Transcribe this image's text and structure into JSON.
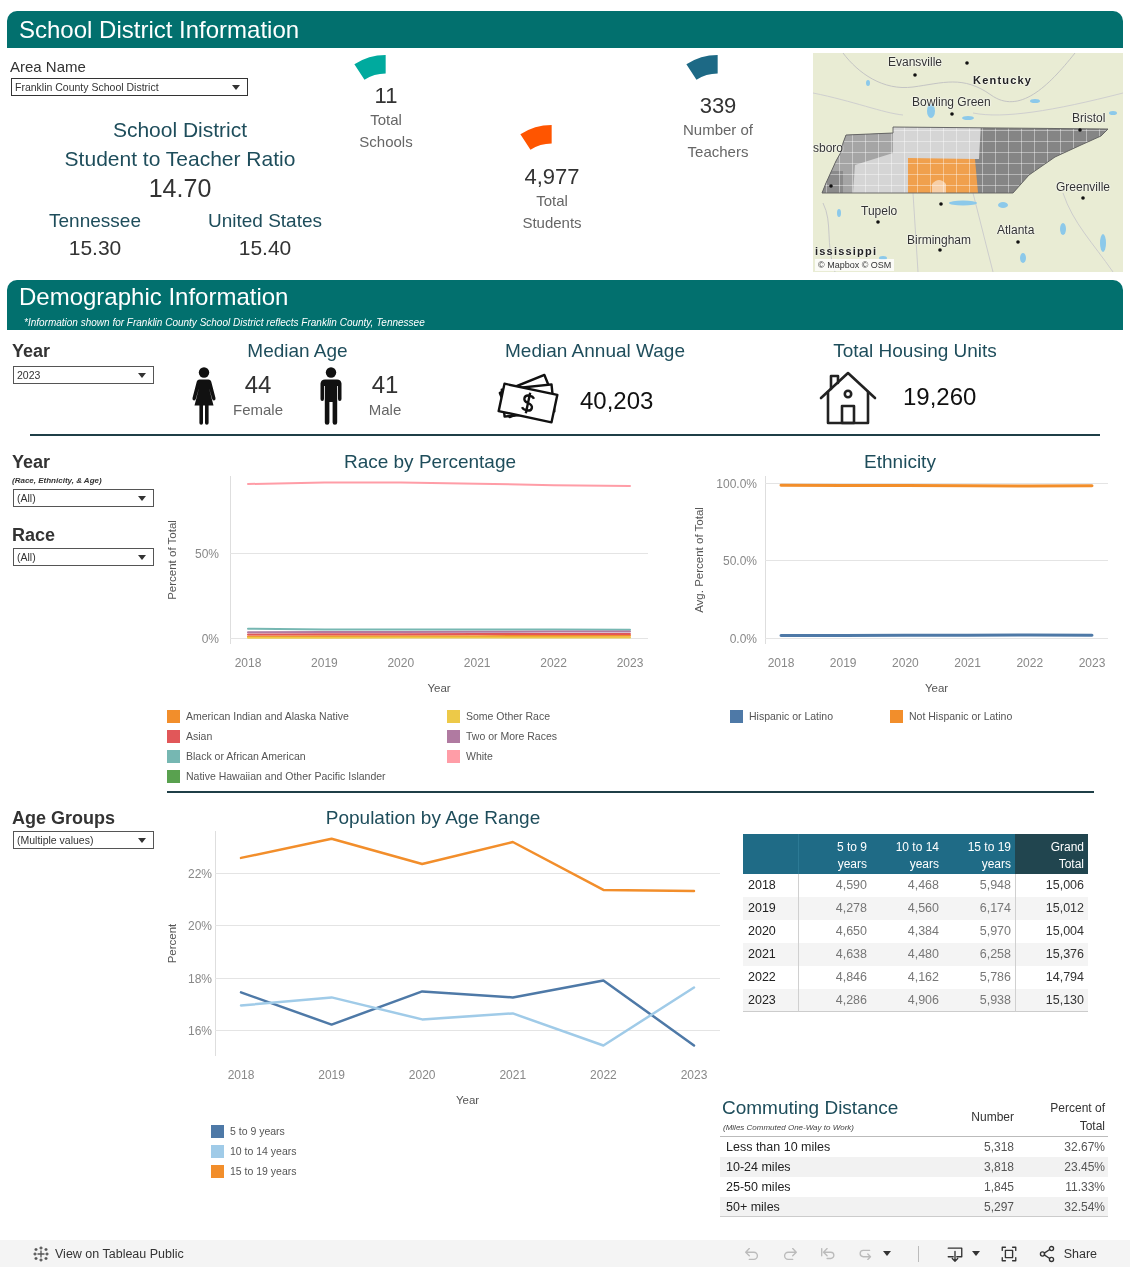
{
  "header": {
    "title": "School District Information"
  },
  "area_filter": {
    "label": "Area Name",
    "value": "Franklin County School District"
  },
  "ratio": {
    "title_lines": [
      "School District",
      "Student to Teacher Ratio"
    ],
    "value": "14.70",
    "comparisons": [
      {
        "label": "Tennessee",
        "value": "15.30"
      },
      {
        "label": "United States",
        "value": "15.40"
      }
    ]
  },
  "kpis": [
    {
      "value": "11",
      "label": "Total Schools",
      "color": "#00aa9e"
    },
    {
      "value": "4,977",
      "label": "Total Students",
      "color": "#ff5500"
    },
    {
      "value": "339",
      "label": "Number of Teachers",
      "color": "#1d6985"
    }
  ],
  "map": {
    "labels": [
      {
        "text": "Evansville",
        "kind": "city"
      },
      {
        "text": "Kentucky",
        "kind": "state"
      },
      {
        "text": "Bowling Green",
        "kind": "city"
      },
      {
        "text": "Bristol",
        "kind": "city"
      },
      {
        "text": "sboro",
        "kind": "city"
      },
      {
        "text": "Greenville",
        "kind": "city"
      },
      {
        "text": "Tupelo",
        "kind": "city"
      },
      {
        "text": "Atlanta",
        "kind": "city"
      },
      {
        "text": "Birmingham",
        "kind": "city"
      },
      {
        "text": "ississippi",
        "kind": "state"
      }
    ],
    "attribution": "© Mapbox © OSM"
  },
  "demographics": {
    "title": "Demographic Information",
    "note": "*Information shown for Franklin County School District reflects Franklin County, Tennessee",
    "year_filter": {
      "label": "Year",
      "value": "2023"
    },
    "median_age": {
      "title": "Median Age",
      "groups": [
        {
          "kind": "female",
          "value": "44",
          "label": "Female"
        },
        {
          "kind": "male",
          "value": "41",
          "label": "Male"
        }
      ]
    },
    "median_wage": {
      "title": "Median Annual Wage",
      "value": "40,203"
    },
    "housing": {
      "title": "Total Housing Units",
      "value": "19,260"
    }
  },
  "filters": [
    {
      "label": "Year",
      "note": "(Race, Ethnicity, & Age)",
      "value": "(All)"
    },
    {
      "label": "Race",
      "value": "(All)"
    }
  ],
  "race_chart": {
    "chart_data": {
      "type": "line",
      "title": "Race by Percentage",
      "xlabel": "Year",
      "ylabel": "Percent of Total",
      "categories": [
        "2018",
        "2019",
        "2020",
        "2021",
        "2022",
        "2023"
      ],
      "series": [
        {
          "name": "American Indian and Alaska Native",
          "color": "#f28e2b",
          "values": [
            0.9,
            1.0,
            1.0,
            1.1,
            1.2,
            1.3
          ]
        },
        {
          "name": "Asian",
          "color": "#e15759",
          "values": [
            2.1,
            2.2,
            2.2,
            2.3,
            2.3,
            2.4
          ]
        },
        {
          "name": "Black or African American",
          "color": "#76b7b2",
          "values": [
            5.5,
            5.0,
            5.1,
            5.1,
            5.0,
            4.9
          ]
        },
        {
          "name": "Native Hawaiian and Other Pacific Islander",
          "color": "#59a14f",
          "values": [
            null,
            null,
            null,
            null,
            null,
            null
          ]
        },
        {
          "name": "Some Other Race",
          "color": "#edc948",
          "values": [
            0.2,
            0.2,
            0.3,
            0.3,
            0.4,
            0.4
          ]
        },
        {
          "name": "Two or More Races",
          "color": "#b07aa1",
          "values": [
            3.4,
            3.5,
            3.6,
            3.7,
            3.8,
            3.9
          ]
        },
        {
          "name": "White",
          "color": "#ff9da7",
          "values": [
            90.6,
            91.4,
            91.4,
            90.8,
            89.9,
            89.5
          ]
        }
      ],
      "ylim": [
        -3.5,
        95.3
      ],
      "yticks": [
        {
          "value": 0,
          "label": "0%"
        },
        {
          "value": 50,
          "label": "50%"
        }
      ],
      "grid": true,
      "legend": "bottom"
    }
  },
  "ethnicity_chart": {
    "chart_data": {
      "type": "line",
      "title": "Ethnicity",
      "xlabel": "Year",
      "ylabel": "Avg. Percent of Total",
      "categories": [
        "2018",
        "2019",
        "2020",
        "2021",
        "2022",
        "2023"
      ],
      "series": [
        {
          "name": "Hispanic or Latino",
          "color": "#4e79a7",
          "values": [
            1.5,
            1.6,
            1.7,
            1.8,
            1.9,
            1.8
          ]
        },
        {
          "name": "Not Hispanic or Latino",
          "color": "#f28e2b",
          "values": [
            98.5,
            98.4,
            98.3,
            98.2,
            98.1,
            98.2
          ]
        }
      ],
      "ylim": [
        -3.9,
        104.5
      ],
      "yticks": [
        {
          "value": 0,
          "label": "0.0%"
        },
        {
          "value": 50,
          "label": "50.0%"
        },
        {
          "value": 100,
          "label": "100.0%"
        }
      ],
      "grid": true,
      "legend": "bottom"
    }
  },
  "age_filter": {
    "label": "Age Groups",
    "value": "(Multiple values)"
  },
  "age_chart": {
    "chart_data": {
      "type": "line",
      "title": "Population by Age Range",
      "xlabel": "Year",
      "ylabel": "Percent",
      "categories": [
        "2018",
        "2019",
        "2020",
        "2021",
        "2022",
        "2023"
      ],
      "series": [
        {
          "name": "5 to 9 years",
          "color": "#4e79a7",
          "values": [
            17.43,
            16.2,
            17.47,
            17.24,
            17.89,
            15.4
          ]
        },
        {
          "name": "10 to 14 years",
          "color": "#a0cbe8",
          "values": [
            16.93,
            17.24,
            16.4,
            16.63,
            15.4,
            17.62
          ]
        },
        {
          "name": "15 to 19 years",
          "color": "#f28e2b",
          "values": [
            22.57,
            23.3,
            22.34,
            23.18,
            21.35,
            21.31
          ]
        }
      ],
      "ylim": [
        15.0,
        23.6
      ],
      "yticks": [
        {
          "value": 16,
          "label": "16%"
        },
        {
          "value": 18,
          "label": "18%"
        },
        {
          "value": 20,
          "label": "20%"
        },
        {
          "value": 22,
          "label": "22%"
        }
      ],
      "grid": true,
      "legend": "bottom"
    }
  },
  "age_table": {
    "columns": [
      "5 to 9 years",
      "10 to 14 years",
      "15 to 19 years",
      "Grand Total"
    ],
    "rows": [
      {
        "year": "2018",
        "values": [
          "4,590",
          "4,468",
          "5,948",
          "15,006"
        ]
      },
      {
        "year": "2019",
        "values": [
          "4,278",
          "4,560",
          "6,174",
          "15,012"
        ]
      },
      {
        "year": "2020",
        "values": [
          "4,650",
          "4,384",
          "5,970",
          "15,004"
        ]
      },
      {
        "year": "2021",
        "values": [
          "4,638",
          "4,480",
          "6,258",
          "15,376"
        ]
      },
      {
        "year": "2022",
        "values": [
          "4,846",
          "4,162",
          "5,786",
          "14,794"
        ]
      },
      {
        "year": "2023",
        "values": [
          "4,286",
          "4,906",
          "5,938",
          "15,130"
        ]
      }
    ]
  },
  "commuting": {
    "title": "Commuting Distance",
    "subtitle": "(Miles Commuted One-Way to Work)",
    "columns": [
      "Number",
      "Percent of Total"
    ],
    "rows": [
      {
        "label": "Less than 10 miles",
        "values": [
          "5,318",
          "32.67%"
        ]
      },
      {
        "label": "10-24 miles",
        "values": [
          "3,818",
          "23.45%"
        ]
      },
      {
        "label": "25-50 miles",
        "values": [
          "1,845",
          "11.33%"
        ]
      },
      {
        "label": "50+ miles",
        "values": [
          "5,297",
          "32.54%"
        ]
      }
    ]
  },
  "toolbar": {
    "link": "View on Tableau Public",
    "history_buttons": [
      {
        "kind": "undo",
        "disabled": true,
        "menu": false
      },
      {
        "kind": "redo",
        "disabled": true,
        "menu": false
      },
      {
        "kind": "revert",
        "disabled": true,
        "menu": false
      },
      {
        "kind": "refresh",
        "disabled": true,
        "menu": true
      }
    ],
    "view_buttons": [
      {
        "kind": "download",
        "disabled": false,
        "menu": true
      },
      {
        "kind": "fullscreen",
        "disabled": false,
        "menu": false
      },
      {
        "kind": "share",
        "disabled": false,
        "menu": false,
        "label": "Share"
      }
    ]
  }
}
